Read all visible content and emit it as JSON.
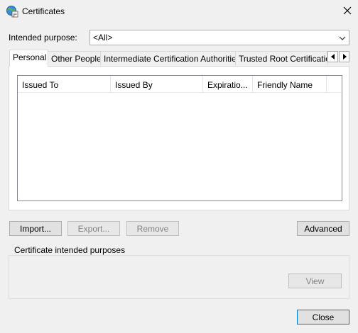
{
  "window": {
    "title": "Certificates"
  },
  "purpose": {
    "label": "Intended purpose:",
    "value": "<All>"
  },
  "tabs": [
    {
      "label": "Personal"
    },
    {
      "label": "Other People"
    },
    {
      "label": "Intermediate Certification Authorities"
    },
    {
      "label": "Trusted Root Certification Authorities"
    }
  ],
  "columns": [
    {
      "label": "Issued To"
    },
    {
      "label": "Issued By"
    },
    {
      "label": "Expiratio..."
    },
    {
      "label": "Friendly Name"
    }
  ],
  "buttons": {
    "import": "Import...",
    "export": "Export...",
    "remove": "Remove",
    "advanced": "Advanced",
    "view": "View",
    "close": "Close"
  },
  "purposes_group": {
    "label": "Certificate intended purposes"
  },
  "icons": {
    "app": "certificate-globe-icon",
    "close": "close-icon",
    "dropdown": "chevron-down-icon",
    "scroll_left": "scroll-left-icon",
    "scroll_right": "scroll-right-icon"
  }
}
